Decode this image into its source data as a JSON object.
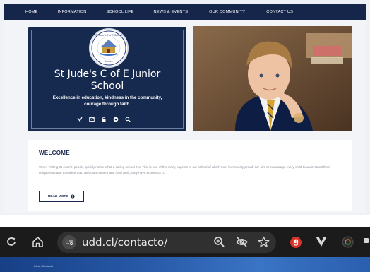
{
  "website": {
    "nav": {
      "items": [
        "HOME",
        "INFORMATION",
        "SCHOOL LIFE",
        "NEWS & EVENTS",
        "OUR COMMUNITY",
        "CONTACT US"
      ],
      "active": "HOME"
    },
    "hero": {
      "crest_text": "St Jude's C of E School · Juniors",
      "title_line1": "St Jude's C of E Junior",
      "title_line2": "School",
      "subtitle_line1": "Excellence in education, kindness in the community,",
      "subtitle_line2": "courage through faith."
    },
    "social_icons": [
      "twitter-icon",
      "email-icon",
      "lock-icon",
      "globe-icon",
      "search-icon"
    ],
    "welcome": {
      "title": "WELCOME",
      "body": "When visiting St Jude's, people quickly notice what a caring school it is. This is one of the many aspects of our school of which I am immensely proud. We aim to encourage every child to understand their uniqueness and to realise that, with commitment and hard work, they have enormous p...",
      "button_label": "READ MORE"
    }
  },
  "browser": {
    "url": "udd.cl/contacto/",
    "icons": [
      "reload-icon",
      "home-icon",
      "site-settings-icon",
      "zoom-icon",
      "eye-off-icon",
      "star-icon",
      "extension-red-icon",
      "extension-v-icon",
      "extension-circle-icon"
    ]
  },
  "next_page": {
    "breadcrumb": "Inicio  /  Contacto"
  },
  "colors": {
    "navy": "#15264a",
    "hero": "#162a4f",
    "browser_bar": "#1b1b1b",
    "url_pill": "#303030",
    "strip": "#285aa8"
  }
}
